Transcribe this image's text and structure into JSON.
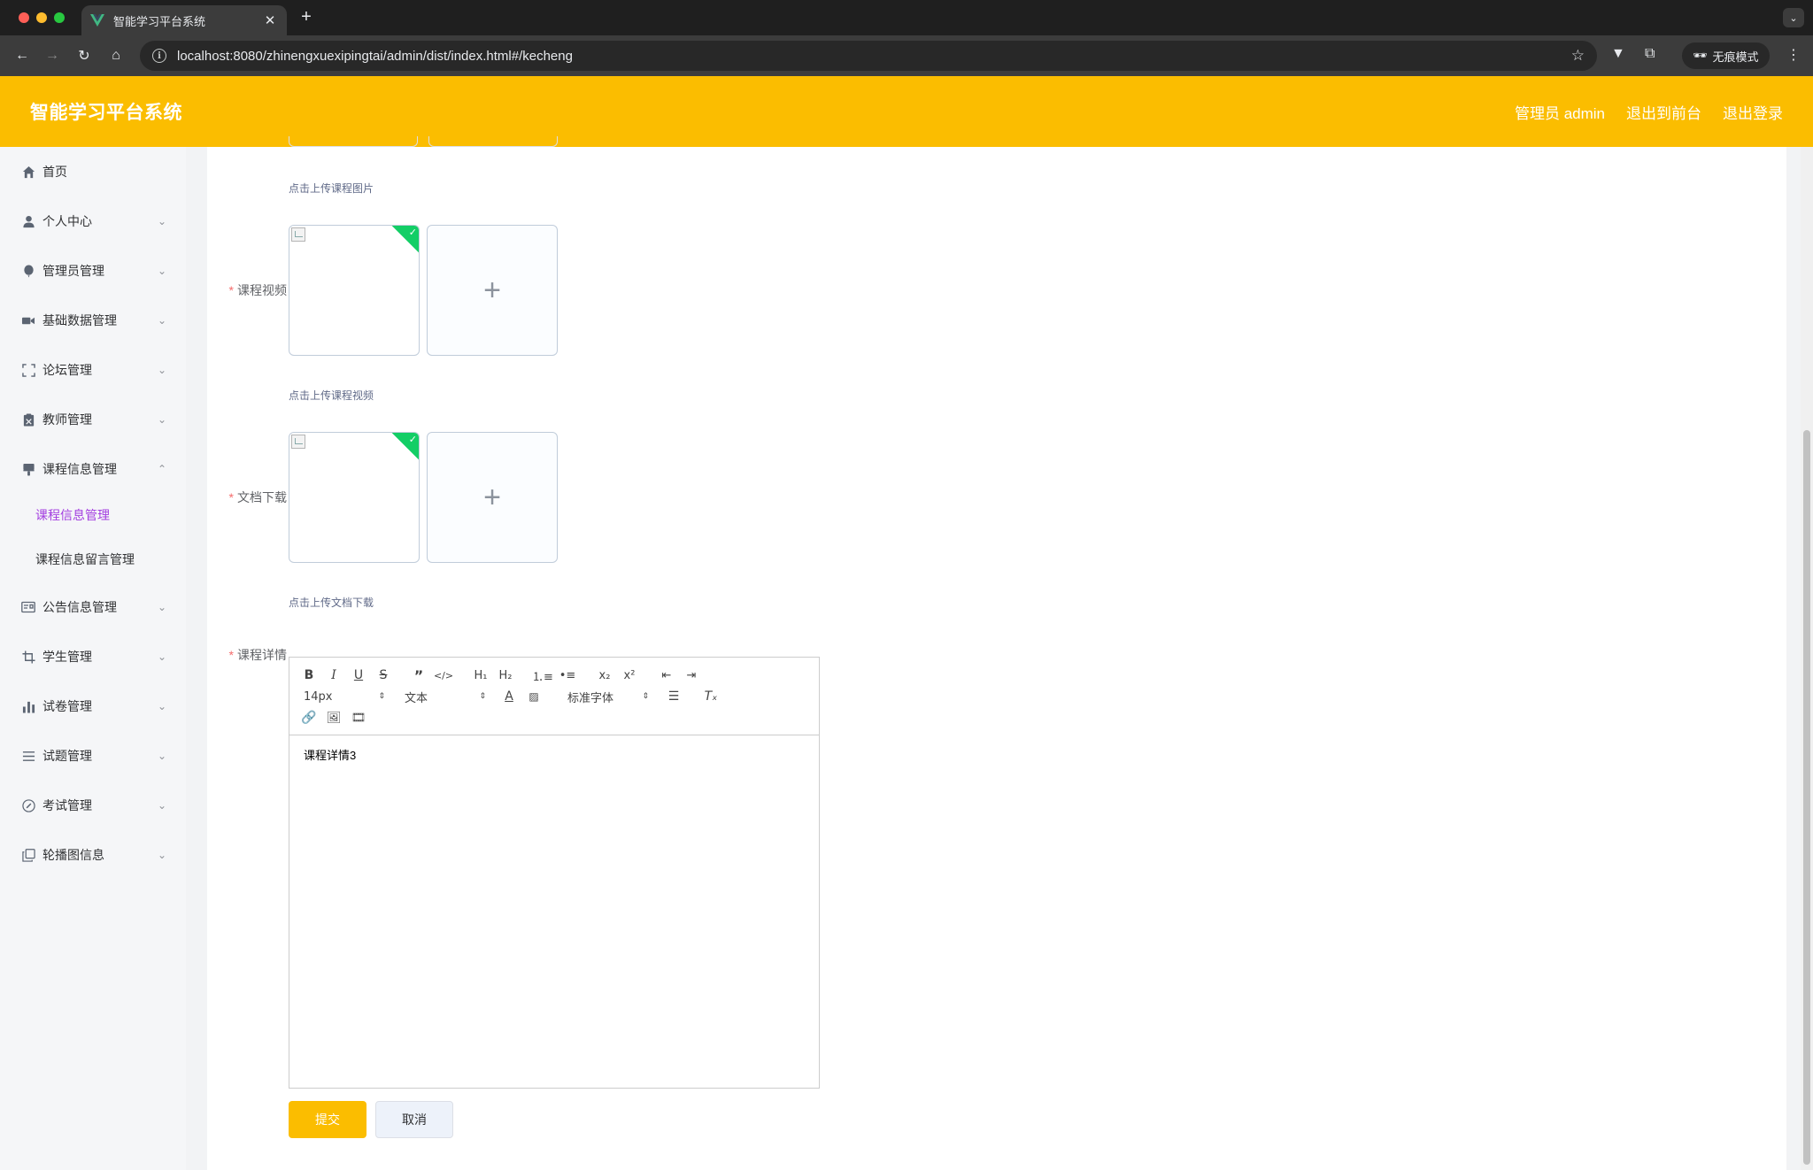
{
  "browser": {
    "tab_title": "智能学习平台系统",
    "url": "localhost:8080/zhinengxuexipingtai/admin/dist/index.html#/kecheng",
    "incognito_label": "无痕模式"
  },
  "header": {
    "title": "智能学习平台系统",
    "user_label": "管理员 admin",
    "to_front_label": "退出到前台",
    "logout_label": "退出登录"
  },
  "sidebar": {
    "items": [
      {
        "label": "首页",
        "icon": "home-icon",
        "expandable": false
      },
      {
        "label": "个人中心",
        "icon": "user-icon",
        "expandable": true
      },
      {
        "label": "管理员管理",
        "icon": "balloon-icon",
        "expandable": true
      },
      {
        "label": "基础数据管理",
        "icon": "video-camera-icon",
        "expandable": true
      },
      {
        "label": "论坛管理",
        "icon": "fullscreen-icon",
        "expandable": true
      },
      {
        "label": "教师管理",
        "icon": "clipboard-icon",
        "expandable": true
      },
      {
        "label": "课程信息管理",
        "icon": "brush-icon",
        "expandable": true,
        "expanded": true
      },
      {
        "label": "公告信息管理",
        "icon": "postcard-icon",
        "expandable": true
      },
      {
        "label": "学生管理",
        "icon": "crop-icon",
        "expandable": true
      },
      {
        "label": "试卷管理",
        "icon": "bar-chart-icon",
        "expandable": true
      },
      {
        "label": "试题管理",
        "icon": "list-icon",
        "expandable": true
      },
      {
        "label": "考试管理",
        "icon": "compass-icon",
        "expandable": true
      },
      {
        "label": "轮播图信息",
        "icon": "copy-icon",
        "expandable": true
      }
    ],
    "submenu": [
      {
        "label": "课程信息管理",
        "active": true
      },
      {
        "label": "课程信息留言管理",
        "active": false
      }
    ],
    "active_color": "#a33ee0"
  },
  "form": {
    "image_hint": "点击上传课程图片",
    "video": {
      "label": "课程视频",
      "hint": "点击上传课程视频"
    },
    "document": {
      "label": "文档下载",
      "hint": "点击上传文档下载"
    },
    "detail": {
      "label": "课程详情",
      "content": "课程详情3",
      "font_size": "14px",
      "header_select": "文本",
      "font_family": "标准字体"
    },
    "submit_label": "提交",
    "cancel_label": "取消"
  },
  "colors": {
    "brand": "#fbbd00",
    "success": "#13ce66",
    "required": "#f56c6c"
  }
}
